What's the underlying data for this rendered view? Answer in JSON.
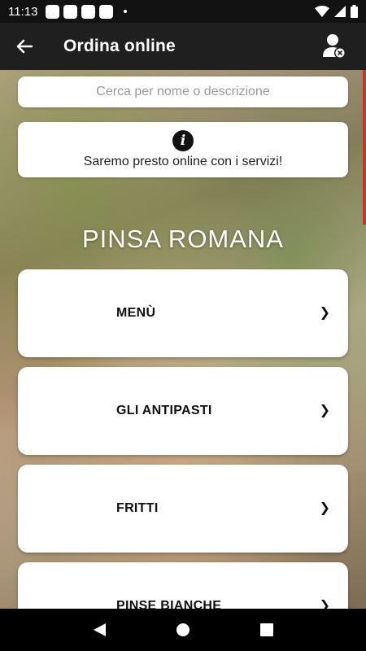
{
  "status_bar": {
    "time": "11:13"
  },
  "app_bar": {
    "title": "Ordina online"
  },
  "search": {
    "placeholder": "Cerca per nome o descrizione",
    "value": ""
  },
  "info": {
    "message": "Saremo presto online con i servizi!"
  },
  "section": {
    "title": "PINSA ROMANA"
  },
  "categories": [
    {
      "label": "MENÙ",
      "chevron": "❯"
    },
    {
      "label": "GLI ANTIPASTI",
      "chevron": "❯"
    },
    {
      "label": "FRITTI",
      "chevron": "❯"
    },
    {
      "label": "PINSE BIANCHE",
      "chevron": "❯"
    }
  ],
  "colors": {
    "app_bar": "#1f1f1f",
    "accent_edge": "#c0392b",
    "card": "#ffffff"
  },
  "icons": [
    "back-arrow-icon",
    "account-remove-icon",
    "info-icon",
    "wifi-icon",
    "signal-icon",
    "battery-icon",
    "nav-back-icon",
    "nav-home-icon",
    "nav-recents-icon"
  ]
}
